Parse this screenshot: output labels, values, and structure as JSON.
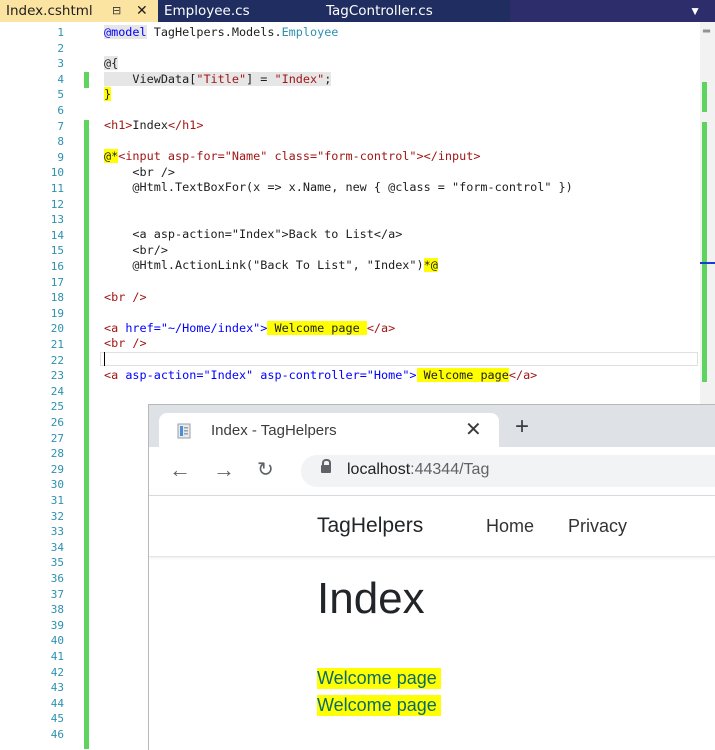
{
  "ide": {
    "tabs": [
      {
        "label": "Index.cshtml",
        "active": true
      },
      {
        "label": "Employee.cs",
        "active": false
      },
      {
        "label": "TagController.cs",
        "active": false
      }
    ],
    "pin_icon": "pin-icon",
    "close_icon": "close-icon",
    "overflow_icon": "dropdown-arrow-icon",
    "colors": {
      "tabbar": "#2d2d6b",
      "active_tab": "#fbe3a1",
      "changebar": "#5fd35f",
      "keyword": "#0000ff",
      "string": "#a31515",
      "type": "#2b91af",
      "highlight": "#ffff00"
    }
  },
  "editor": {
    "line_numbers": [
      "1",
      "2",
      "3",
      "4",
      "5",
      "6",
      "7",
      "8",
      "9",
      "10",
      "11",
      "12",
      "13",
      "14",
      "15",
      "16",
      "17",
      "18",
      "19",
      "20",
      "21",
      "22",
      "23",
      "24",
      "25",
      "26",
      "27",
      "28",
      "29",
      "30",
      "31",
      "32",
      "33",
      "34",
      "35",
      "36",
      "37",
      "38",
      "39",
      "40",
      "41",
      "42",
      "43",
      "44",
      "45",
      "46"
    ],
    "code": {
      "l1a": "@model",
      "l1b": " TagHelpers.Models.",
      "l1c": "Employee",
      "l3": "@{",
      "l4a": "    ViewData[",
      "l4b": "\"Title\"",
      "l4c": "] = ",
      "l4d": "\"Index\"",
      "l4e": ";",
      "l5": "}",
      "l7a": "<h1>",
      "l7b": "Index",
      "l7c": "</h1>",
      "l9a": "@*",
      "l9b": "<input asp-for=\"Name\" class=\"form-control\"></input>",
      "l10": "    <br />",
      "l11": "    @Html.TextBoxFor(x => x.Name, new { @class = \"form-control\" })",
      "l14": "    <a asp-action=\"Index\">Back to List</a>",
      "l15": "    <br/>",
      "l16a": "    @Html.ActionLink(\"Back To List\", \"Index\")",
      "l16b": "*@",
      "l18": "<br />",
      "l20a": "<a ",
      "l20b": "href",
      "l20c": "=\"~/Home/index\">",
      "l20d": " Welcome page ",
      "l20e": "</a>",
      "l21": "<br />",
      "l23a": "<a ",
      "l23b": "asp-action",
      "l23c": "=\"Index\" ",
      "l23d": "asp-controller",
      "l23e": "=\"Home\">",
      "l23f": " Welcome page",
      "l23g": "</a>"
    }
  },
  "browser": {
    "tab_title": "Index - TagHelpers",
    "tab_icon": "page-icon",
    "new_tab": "+",
    "url_host": "localhost",
    "url_path": ":44344/Tag",
    "site": {
      "brand": "TagHelpers",
      "nav": [
        "Home",
        "Privacy"
      ],
      "heading": "Index",
      "links": [
        "Welcome page",
        "Welcome page"
      ]
    }
  }
}
